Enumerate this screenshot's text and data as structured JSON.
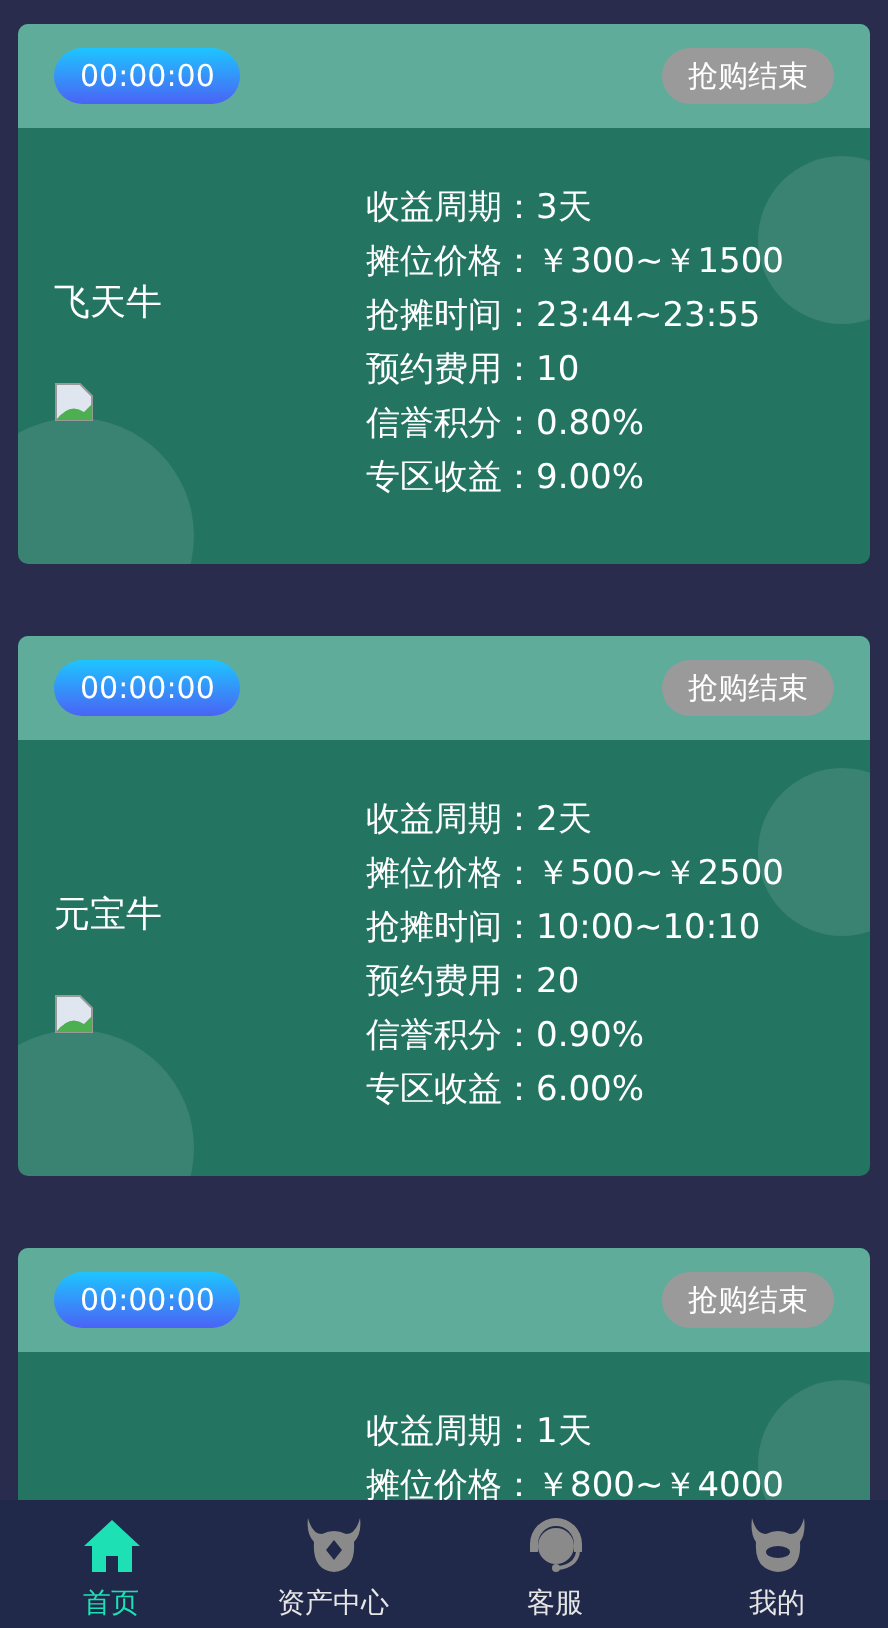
{
  "cards": [
    {
      "timer": "00:00:00",
      "status": "抢购结束",
      "name": "飞天牛",
      "has_image": true,
      "rows": [
        "收益周期：3天",
        "摊位价格：￥300~￥1500",
        "抢摊时间：23:44~23:55",
        "预约费用：10",
        "信誉积分：0.80%",
        "专区收益：9.00%"
      ]
    },
    {
      "timer": "00:00:00",
      "status": "抢购结束",
      "name": "元宝牛",
      "has_image": true,
      "rows": [
        "收益周期：2天",
        "摊位价格：￥500~￥2500",
        "抢摊时间：10:00~10:10",
        "预约费用：20",
        "信誉积分：0.90%",
        "专区收益：6.00%"
      ]
    },
    {
      "timer": "00:00:00",
      "status": "抢购结束",
      "rows": [
        "收益周期：1天",
        "摊位价格：￥800~￥4000"
      ]
    }
  ],
  "nav": [
    {
      "kind": "home",
      "label": "首页",
      "selected": true
    },
    {
      "kind": "assets",
      "label": "资产中心",
      "selected": false
    },
    {
      "kind": "service",
      "label": "客服",
      "selected": false
    },
    {
      "kind": "me",
      "label": "我的",
      "selected": false
    }
  ]
}
